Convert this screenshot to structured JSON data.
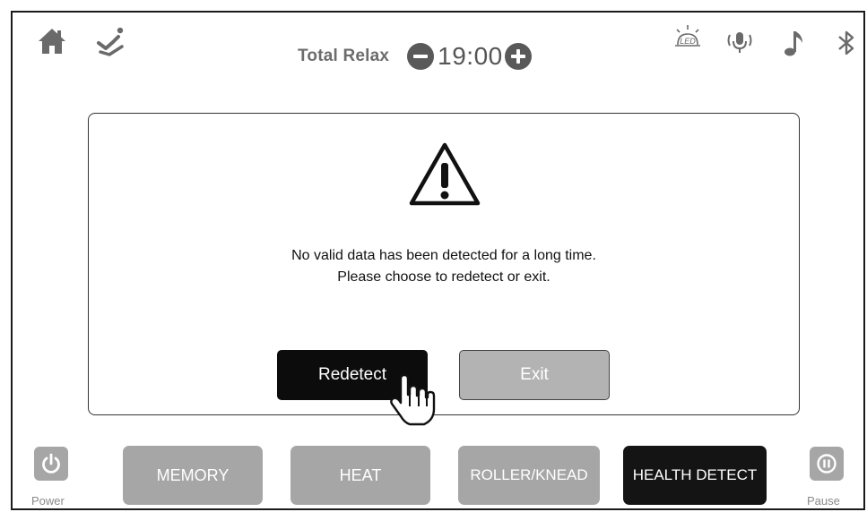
{
  "header": {
    "mode_label": "Total Relax",
    "timer": "19:00",
    "icons": [
      "home-icon",
      "recline-icon",
      "led-icon",
      "voice-icon",
      "music-icon",
      "bluetooth-icon"
    ],
    "led_text": "LED"
  },
  "dialog": {
    "icon": "warning-icon",
    "message_line1": "No valid data has been detected for a long time.",
    "message_line2": "Please choose to redetect or exit.",
    "redetect_label": "Redetect",
    "exit_label": "Exit"
  },
  "bottom_bar": {
    "power_label": "Power",
    "pause_label": "Pause",
    "menu": [
      {
        "label": "MEMORY",
        "active": false
      },
      {
        "label": "HEAT",
        "active": false
      },
      {
        "label": "ROLLER/KNEAD",
        "active": false
      },
      {
        "label": "HEALTH DETECT",
        "active": true
      }
    ]
  },
  "colors": {
    "active_button": "#0c0c0c",
    "inactive_button": "#a6a6a6",
    "icon_gray": "#6a6a6a"
  }
}
